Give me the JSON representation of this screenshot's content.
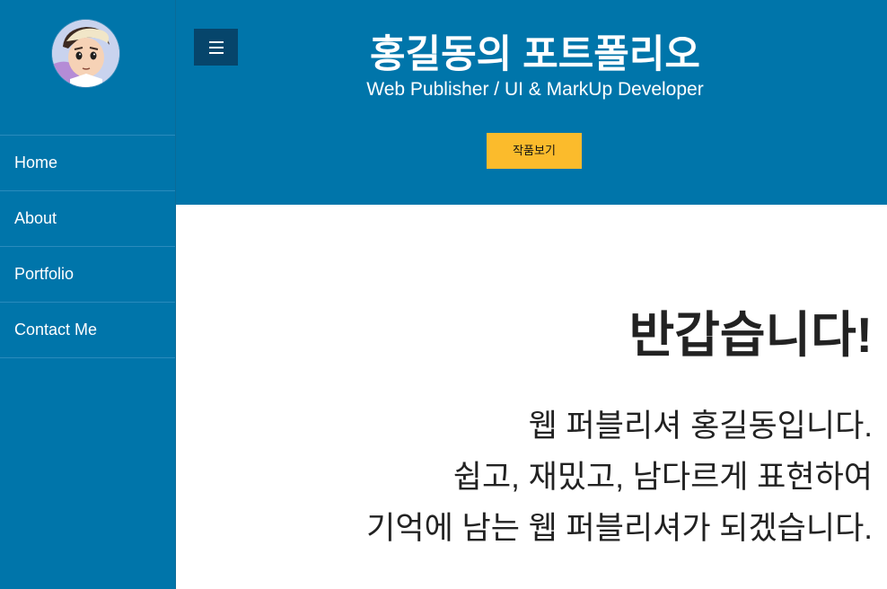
{
  "sidebar": {
    "avatar_alt": "profile avatar",
    "items": [
      {
        "label": "Home"
      },
      {
        "label": "About"
      },
      {
        "label": "Portfolio"
      },
      {
        "label": "Contact Me"
      }
    ]
  },
  "header": {
    "menu_icon": "hamburger-menu-icon",
    "title": "홍길동의 포트폴리오",
    "subtitle": "Web Publisher / UI & MarkUp Developer",
    "cta_label": "작품보기"
  },
  "main": {
    "greeting": "반갑습니다!",
    "intro": [
      "웹 퍼블리셔 홍길동입니다.",
      "쉽고, 재밌고, 남다르게 표현하여",
      "기억에 남는 웹 퍼블리셔가 되겠습니다."
    ]
  },
  "colors": {
    "primary": "#0075aa",
    "menu_button": "#06456b",
    "accent": "#fbbb2c",
    "text_dark": "#222222"
  }
}
